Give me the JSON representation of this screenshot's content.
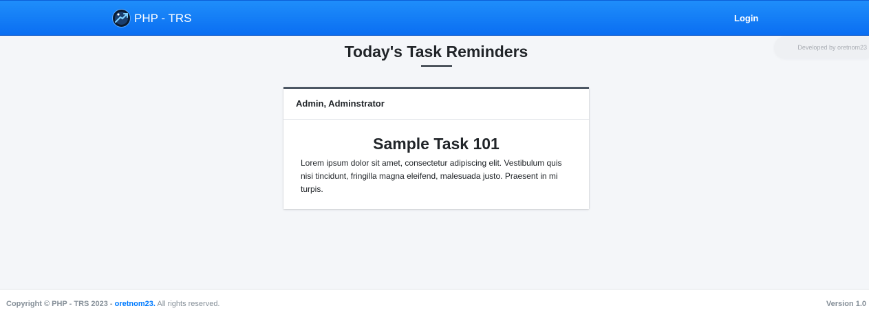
{
  "navbar": {
    "brand_text": "PHP - TRS",
    "login_label": "Login",
    "colors": {
      "background": "#1877f2",
      "text": "#ffffff"
    }
  },
  "badge": {
    "developed_by": "Developed by oretnom23"
  },
  "main": {
    "title": "Today's Task Reminders",
    "card": {
      "header": "Admin, Adminstrator",
      "task_title": "Sample Task 101",
      "task_description": "Lorem ipsum dolor sit amet, consectetur adipiscing elit. Vestibulum quis nisi tincidunt, fringilla magna eleifend, malesuada justo. Praesent in mi turpis."
    }
  },
  "footer": {
    "copyright_prefix": "Copyright © PHP - TRS 2023 - ",
    "author_link": "oretnom23.",
    "rights": " All rights reserved.",
    "version": "Version 1.0",
    "link_color": "#007bff"
  }
}
